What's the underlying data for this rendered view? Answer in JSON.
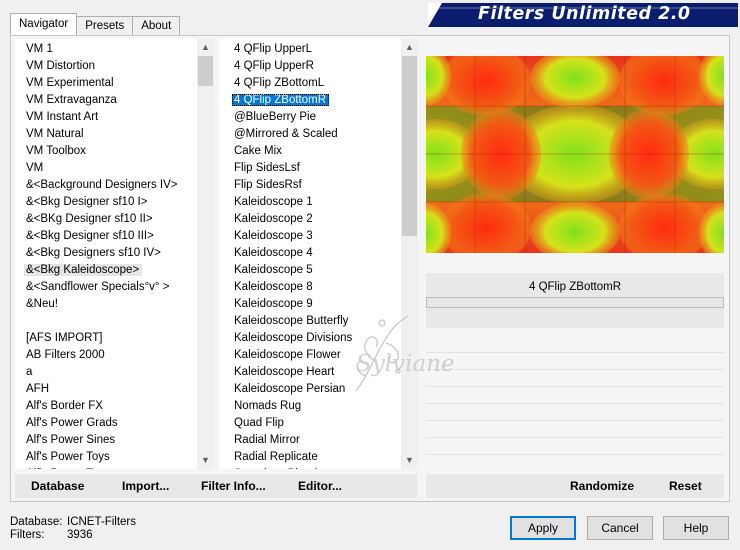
{
  "tabs": [
    {
      "label": "Navigator",
      "active": true
    },
    {
      "label": "Presets",
      "active": false
    },
    {
      "label": "About",
      "active": false
    }
  ],
  "banner_title": "Filters Unlimited 2.0",
  "categories": {
    "items": [
      "VM 1",
      "VM Distortion",
      "VM Experimental",
      "VM Extravaganza",
      "VM Instant Art",
      "VM Natural",
      "VM Toolbox",
      "VM",
      "&<Background Designers IV>",
      "&<Bkg Designer sf10 I>",
      "&<BKg Designer sf10 II>",
      "&<Bkg Designer sf10 III>",
      "&<Bkg Designers sf10 IV>",
      "&<Bkg Kaleidoscope>",
      "&<Sandflower Specials°v° >",
      "&Neu!",
      "",
      "[AFS IMPORT]",
      "AB Filters 2000",
      "a",
      "AFH",
      "Alf's Border FX",
      "Alf's Power Grads",
      "Alf's Power Sines",
      "Alf's Power Toys",
      "Alf's Power Toys"
    ],
    "highlighted_index": 13
  },
  "filters": {
    "items": [
      "4 QFlip UpperL",
      "4 QFlip UpperR",
      "4 QFlip ZBottomL",
      "4 QFlip ZBottomR",
      "@BlueBerry Pie",
      "@Mirrored & Scaled",
      "Cake Mix",
      "Flip SidesLsf",
      "Flip SidesRsf",
      "Kaleidoscope 1",
      "Kaleidoscope 2",
      "Kaleidoscope 3",
      "Kaleidoscope 4",
      "Kaleidoscope 5",
      "Kaleidoscope 8",
      "Kaleidoscope 9",
      "Kaleidoscope Butterfly",
      "Kaleidoscope Divisions",
      "Kaleidoscope Flower",
      "Kaleidoscope Heart",
      "Kaleidoscope Persian",
      "Nomads Rug",
      "Quad Flip",
      "Radial Mirror",
      "Radial Replicate",
      "Seamless Blend"
    ],
    "selected_index": 3
  },
  "selected_filter_name": "4 QFlip ZBottomR",
  "watermark_text": "Sylviane",
  "toolbar": {
    "database": "Database",
    "import": "Import...",
    "filter_info": "Filter Info...",
    "editor": "Editor...",
    "randomize": "Randomize",
    "reset": "Reset"
  },
  "status": {
    "database_label": "Database:",
    "database_value": "ICNET-Filters",
    "filters_label": "Filters:",
    "filters_value": "3936"
  },
  "buttons": {
    "apply": "Apply",
    "cancel": "Cancel",
    "help": "Help"
  },
  "colors": {
    "banner": "#0a1d6e",
    "selection": "#0078d7",
    "preview_red": "#e8341a",
    "preview_green": "#6cc41a",
    "preview_yellow": "#f2e01c"
  }
}
